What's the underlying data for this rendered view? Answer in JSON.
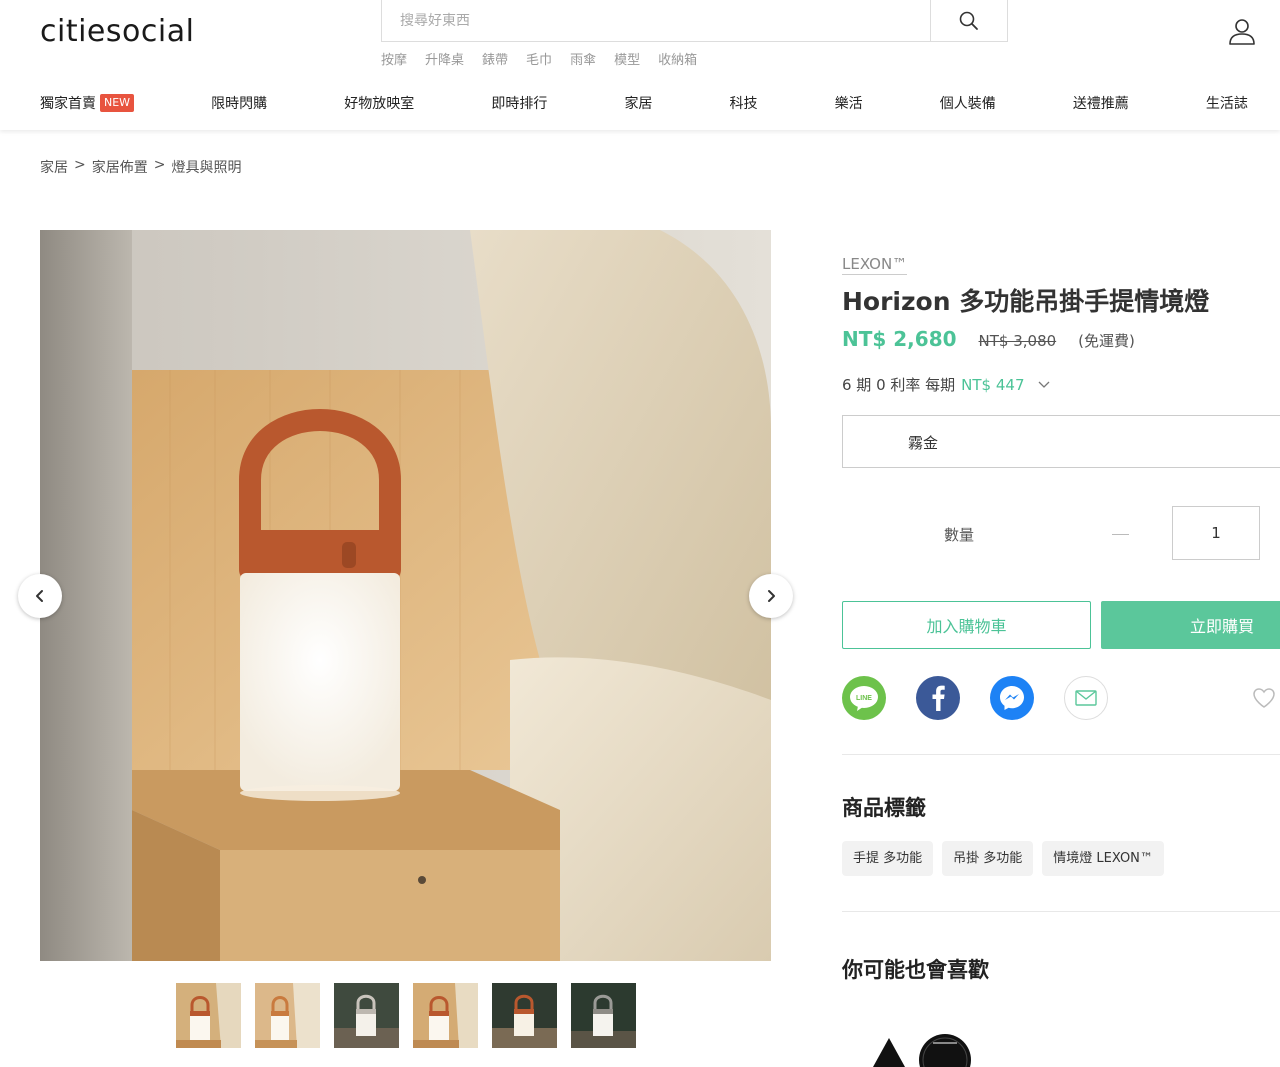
{
  "header": {
    "logo_text": "citiesocial",
    "search_placeholder": "搜尋好東西",
    "hot_keywords": [
      "按摩",
      "升降桌",
      "錶帶",
      "毛巾",
      "雨傘",
      "模型",
      "收納箱"
    ]
  },
  "nav": {
    "items": [
      {
        "label": "獨家首賣",
        "badge": "NEW"
      },
      {
        "label": "限時閃購"
      },
      {
        "label": "好物放映室"
      },
      {
        "label": "即時排行"
      },
      {
        "label": "家居"
      },
      {
        "label": "科技"
      },
      {
        "label": "樂活"
      },
      {
        "label": "個人裝備"
      },
      {
        "label": "送禮推薦"
      },
      {
        "label": "生活誌"
      }
    ]
  },
  "breadcrumb": {
    "items": [
      "家居",
      "家居佈置",
      "燈具與照明"
    ],
    "separator": ">"
  },
  "product": {
    "brand": "LEXON™",
    "title": "Horizon 多功能吊掛手提情境燈",
    "price": "NT$ 2,680",
    "original_price": "NT$ 3,080",
    "shipping_note": "(免運費)",
    "installment_prefix": "6 期 0 利率 每期",
    "installment_amount": "NT$ 447",
    "variant": "霧金",
    "quantity_label": "數量",
    "quantity_value": "1",
    "add_to_cart": "加入購物車",
    "buy_now": "立即購買",
    "thumbnail_count": 6
  },
  "share": {
    "line_text": "LINE"
  },
  "tags_section": {
    "title": "商品標籤",
    "tags": [
      "手提 多功能",
      "吊掛 多功能",
      "情境燈 LEXON™"
    ]
  },
  "recommend_section": {
    "title": "你可能也會喜歡"
  },
  "colors": {
    "accent_green": "#4cc397",
    "buy_button": "#5bc79b",
    "new_badge": "#e8543f",
    "lamp_handle": "#b9582e"
  }
}
